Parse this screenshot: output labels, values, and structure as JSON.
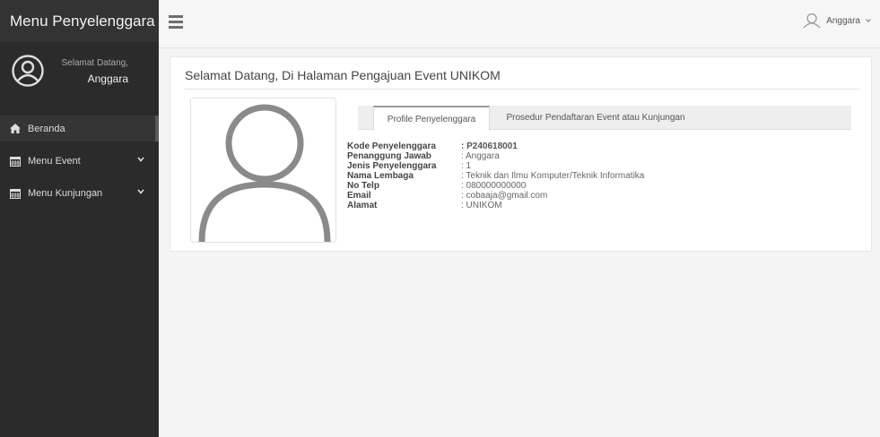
{
  "sidebar": {
    "brand": "Menu Penyelenggara",
    "greeting": "Selamat Datang,",
    "username": "Anggara",
    "items": [
      {
        "label": "Beranda",
        "icon": "home-icon"
      },
      {
        "label": "Menu Event",
        "icon": "calendar-icon"
      },
      {
        "label": "Menu Kunjungan",
        "icon": "calendar-icon"
      }
    ]
  },
  "topbar": {
    "user_label": "Anggara"
  },
  "main": {
    "title": "Selamat Datang, Di Halaman Pengajuan Event UNIKOM",
    "tabs": [
      {
        "label": "Profile Penyelenggara"
      },
      {
        "label": "Prosedur Pendaftaran Event atau Kunjungan"
      }
    ],
    "profile": [
      {
        "key": "Kode Penyelenggara",
        "value": ": P240618001"
      },
      {
        "key": "Penanggung Jawab",
        "value": ": Anggara"
      },
      {
        "key": "Jenis Penyelenggara",
        "value": ": 1"
      },
      {
        "key": "Nama Lembaga",
        "value": ": Teknik dan Ilmu Komputer/Teknik Informatika"
      },
      {
        "key": "No Telp",
        "value": ": 080000000000"
      },
      {
        "key": "Email",
        "value": ": cobaaja@gmail.com"
      },
      {
        "key": "Alamat",
        "value": ": UNIKOM"
      }
    ]
  },
  "colors": {
    "sidebar_bg": "#2b2b2b",
    "brand_bg": "#333333",
    "content_bg": "#f4f4f4"
  }
}
